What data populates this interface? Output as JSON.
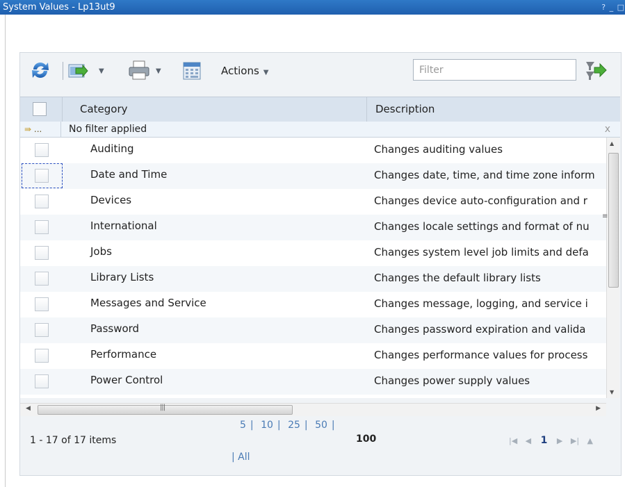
{
  "window": {
    "title": "System Values - Lp13ut9",
    "controls": "? _ □"
  },
  "toolbar": {
    "actions_label": "Actions",
    "filter_placeholder": "Filter",
    "icons": [
      "refresh-icon",
      "export-icon",
      "print-icon",
      "calculator-icon",
      "apply-filter-icon"
    ]
  },
  "table": {
    "columns": [
      "Category",
      "Description"
    ],
    "filter_status": "No filter applied",
    "filter_icon_label": "...",
    "clear_filter": "x",
    "rows": [
      {
        "category": "Auditing",
        "description": "Changes auditing values"
      },
      {
        "category": "Date and Time",
        "description": "Changes date, time, and time zone inform"
      },
      {
        "category": "Devices",
        "description": "Changes device auto-configuration and r"
      },
      {
        "category": "International",
        "description": "Changes locale settings and format of nu"
      },
      {
        "category": "Jobs",
        "description": "Changes system level job limits and defa"
      },
      {
        "category": "Library Lists",
        "description": "Changes the default library lists"
      },
      {
        "category": "Messages and Service",
        "description": "Changes message, logging, and service i"
      },
      {
        "category": "Password",
        "description": "Changes password expiration and valida"
      },
      {
        "category": "Performance",
        "description": "Changes performance values for process"
      },
      {
        "category": "Power Control",
        "description": "Changes power supply values"
      }
    ]
  },
  "footer": {
    "item_count": "1 - 17 of 17 items",
    "page_sizes": [
      "5",
      "10",
      "25",
      "50"
    ],
    "page_size_selected": "100",
    "page_size_all": "All",
    "current_page": "1"
  },
  "colors": {
    "titlebar": "#2468b8",
    "header": "#d9e3ee",
    "link": "#4a7bb5"
  }
}
